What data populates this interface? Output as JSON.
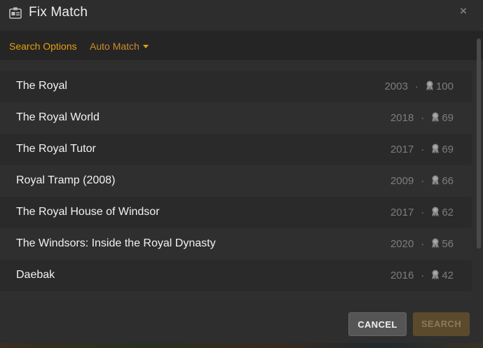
{
  "dialog": {
    "title": "Fix Match",
    "close_glyph": "×"
  },
  "options": {
    "search_options_label": "Search Options",
    "auto_match_label": "Auto Match"
  },
  "results": [
    {
      "title": "The Royal",
      "year": "2003",
      "score": "100"
    },
    {
      "title": "The Royal World",
      "year": "2018",
      "score": "69"
    },
    {
      "title": "The Royal Tutor",
      "year": "2017",
      "score": "69"
    },
    {
      "title": "Royal Tramp (2008)",
      "year": "2009",
      "score": "66"
    },
    {
      "title": "The Royal House of Windsor",
      "year": "2017",
      "score": "62"
    },
    {
      "title": "The Windsors: Inside the Royal Dynasty",
      "year": "2020",
      "score": "56"
    },
    {
      "title": "Daebak",
      "year": "2016",
      "score": "42"
    },
    {
      "title": "",
      "year": "",
      "score": ""
    }
  ],
  "footer": {
    "cancel_label": "CANCEL",
    "search_label": "SEARCH"
  },
  "icons": {
    "header": "id-card-icon",
    "score": "medal-icon",
    "close": "close-icon",
    "dropdown": "caret-down-icon"
  },
  "colors": {
    "accent": "#e5a00d",
    "background": "#2e2e2e",
    "text": "#f2f2f2",
    "muted": "#7d7d7d"
  }
}
